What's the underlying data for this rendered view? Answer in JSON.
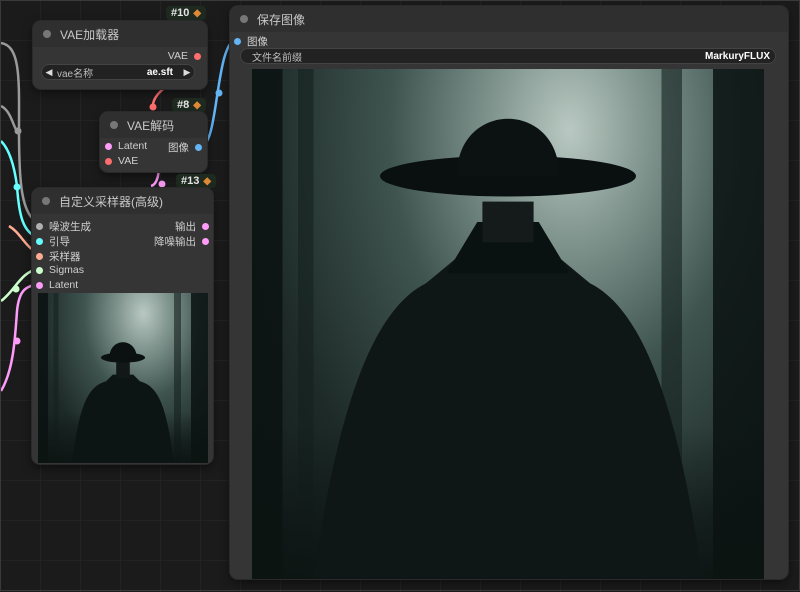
{
  "nodes": {
    "vae_loader": {
      "id_badge": "#10",
      "title": "VAE加载器",
      "output_label": "VAE",
      "widget": {
        "label": "vae名称",
        "value": "ae.sft"
      }
    },
    "vae_decode": {
      "id_badge": "#8",
      "title": "VAE解码",
      "inputs": [
        "Latent",
        "VAE"
      ],
      "output_label": "图像"
    },
    "sampler": {
      "id_badge": "#13",
      "title": "自定义采样器(高级)",
      "inputs": [
        "噪波生成",
        "引导",
        "采样器",
        "Sigmas",
        "Latent"
      ],
      "outputs": [
        "输出",
        "降噪输出"
      ]
    },
    "save_image": {
      "title": "保存图像",
      "input_label": "图像",
      "widget": {
        "label": "文件名前缀",
        "value": "MarkuryFLUX"
      }
    }
  },
  "colors": {
    "vae": "#ff6e6e",
    "latent": "#ff9cf9",
    "image": "#64b5f6",
    "noise": "#b0b0b0",
    "guider": "#66ffff",
    "sampler": "#ffab91",
    "sigmas": "#cdffcd"
  },
  "icons": {
    "badge_icon": "fox-icon",
    "arrow_left": "triangle-left-icon",
    "arrow_right": "triangle-right-icon"
  }
}
